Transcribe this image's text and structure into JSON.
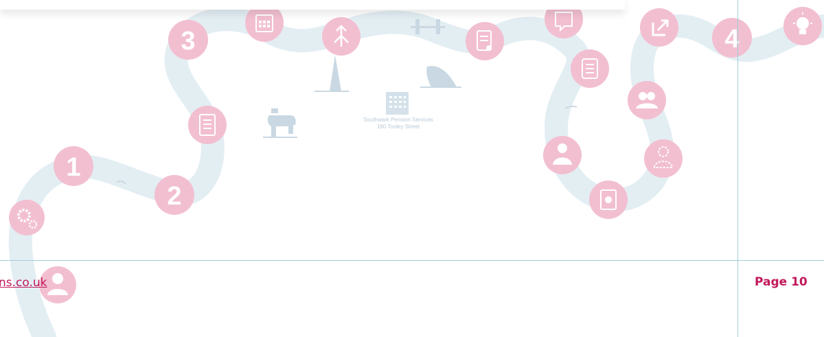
{
  "footer": {
    "link_text": "ns.co.uk",
    "page_label": "Page 10"
  },
  "building": {
    "line1": "Southwark Pension Services",
    "line2": "160 Tooley Street"
  },
  "milestones": [
    "1",
    "2",
    "3",
    "4"
  ],
  "colors": {
    "path": "#e3eef3",
    "circle": "#f2bfd1",
    "accent": "#c2185b",
    "landmark": "#c9d8e2"
  }
}
